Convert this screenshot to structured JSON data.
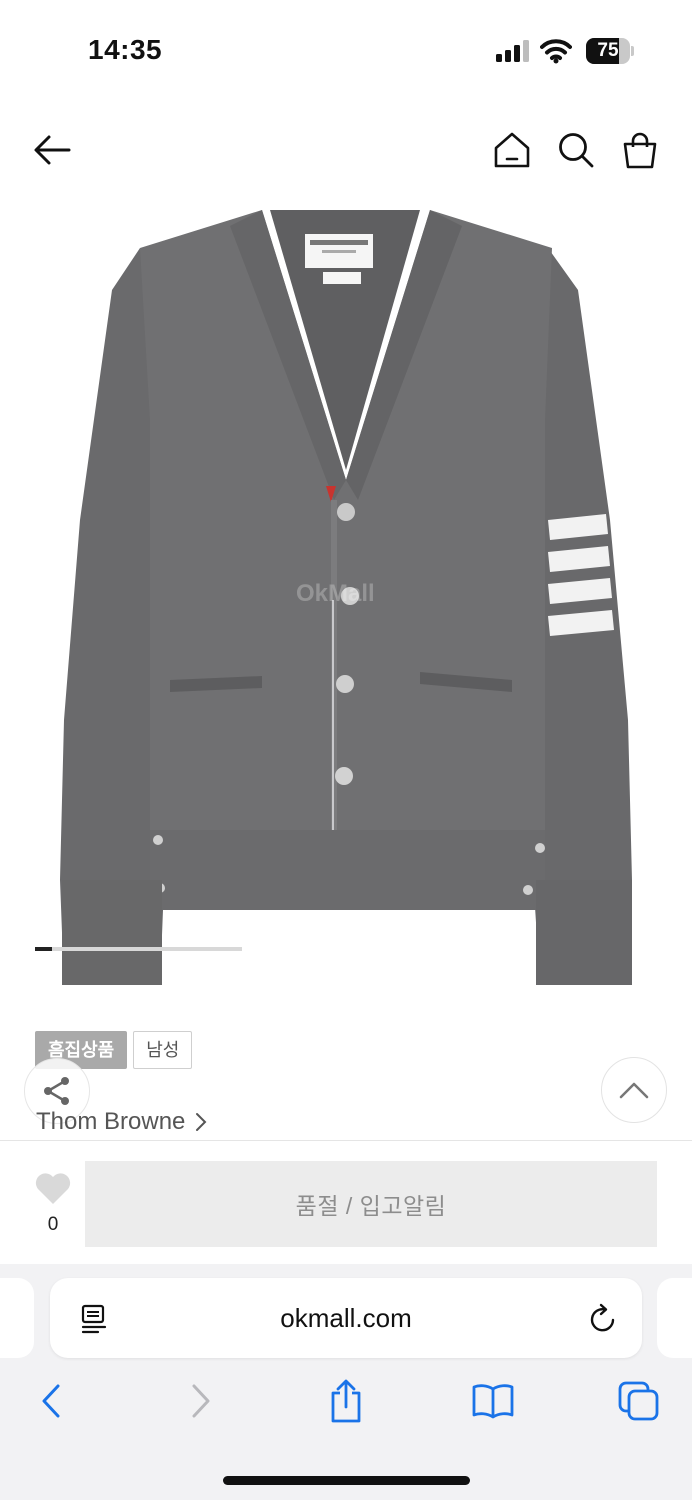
{
  "status_bar": {
    "time": "14:35",
    "battery_level": "75",
    "battery_fraction": 0.75,
    "icons": [
      "signal-icon",
      "wifi-icon",
      "battery-icon"
    ]
  },
  "header": {
    "icons": [
      "back-arrow-icon",
      "home-icon",
      "search-icon",
      "shopping-bag-icon"
    ]
  },
  "product": {
    "image_watermark": "OkMall",
    "gallery_progress": 0.08,
    "badges": [
      "흠집상품",
      "남성"
    ],
    "brand": "Thom Browne",
    "brand_chevron": ">"
  },
  "actions": {
    "share_icon": "share-icon",
    "scroll_top_icon": "chevron-up-icon",
    "wish_count": "0",
    "soldout_label": "품절 / 입고알림"
  },
  "browser": {
    "url": "okmall.com",
    "icons": [
      "page-menu-icon",
      "reload-icon",
      "back-icon",
      "forward-icon",
      "share-icon",
      "bookmarks-icon",
      "tabs-icon"
    ]
  }
}
